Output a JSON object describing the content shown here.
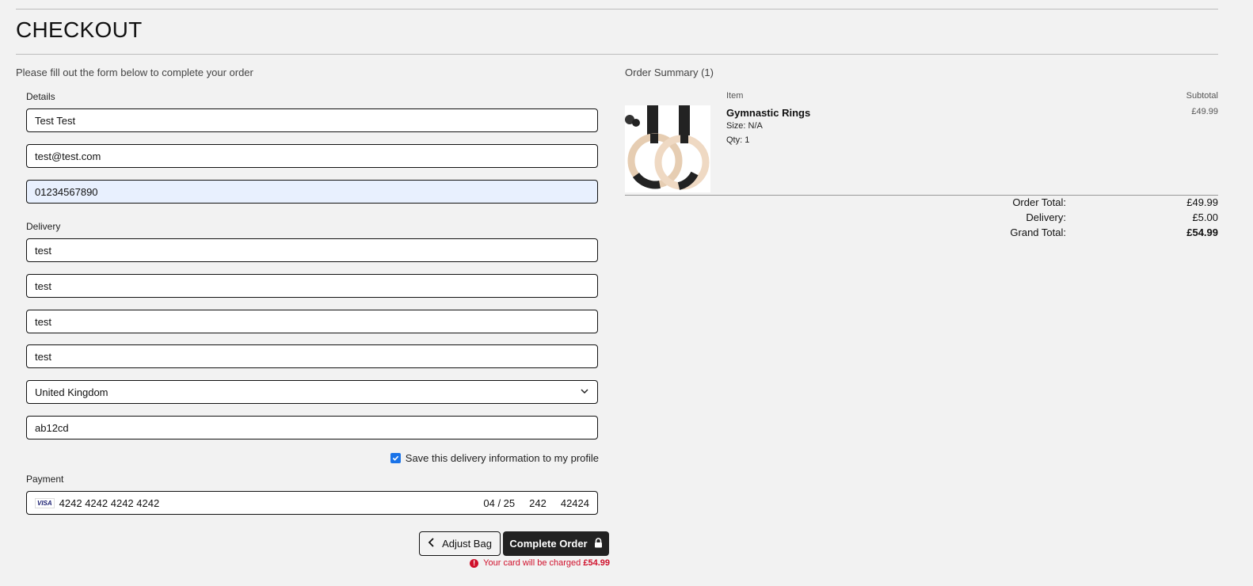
{
  "page": {
    "title": "CHECKOUT",
    "intro": "Please fill out the form below to complete your order"
  },
  "details": {
    "label": "Details",
    "full_name": "Test Test",
    "email": "test@test.com",
    "phone": "01234567890"
  },
  "delivery": {
    "label": "Delivery",
    "street1": "test",
    "street2": "test",
    "town": "test",
    "county": "test",
    "country": "United Kingdom",
    "postcode": "ab12cd",
    "save_label": "Save this delivery information to my profile",
    "save_checked": true
  },
  "payment": {
    "label": "Payment",
    "card_brand": "VISA",
    "card_number": "4242 4242 4242 4242",
    "expiry": "04 / 25",
    "cvc": "242",
    "postal": "42424"
  },
  "actions": {
    "adjust_bag": "Adjust Bag",
    "complete_order": "Complete Order",
    "charge_note": "Your card will be charged",
    "charge_amount": "£54.99"
  },
  "summary": {
    "title": "Order Summary (1)",
    "col_item": "Item",
    "col_subtotal": "Subtotal",
    "items": [
      {
        "name": "Gymnastic Rings",
        "size": "Size: N/A",
        "qty": "Qty: 1",
        "subtotal": "£49.99"
      }
    ],
    "order_total_label": "Order Total:",
    "order_total": "£49.99",
    "delivery_label": "Delivery:",
    "delivery": "£5.00",
    "grand_total_label": "Grand Total:",
    "grand_total": "£54.99"
  },
  "colors": {
    "accent_dark": "#222222",
    "error": "#d0102b",
    "checkbox": "#1a73e8",
    "autofill": "#e8f0fe"
  }
}
